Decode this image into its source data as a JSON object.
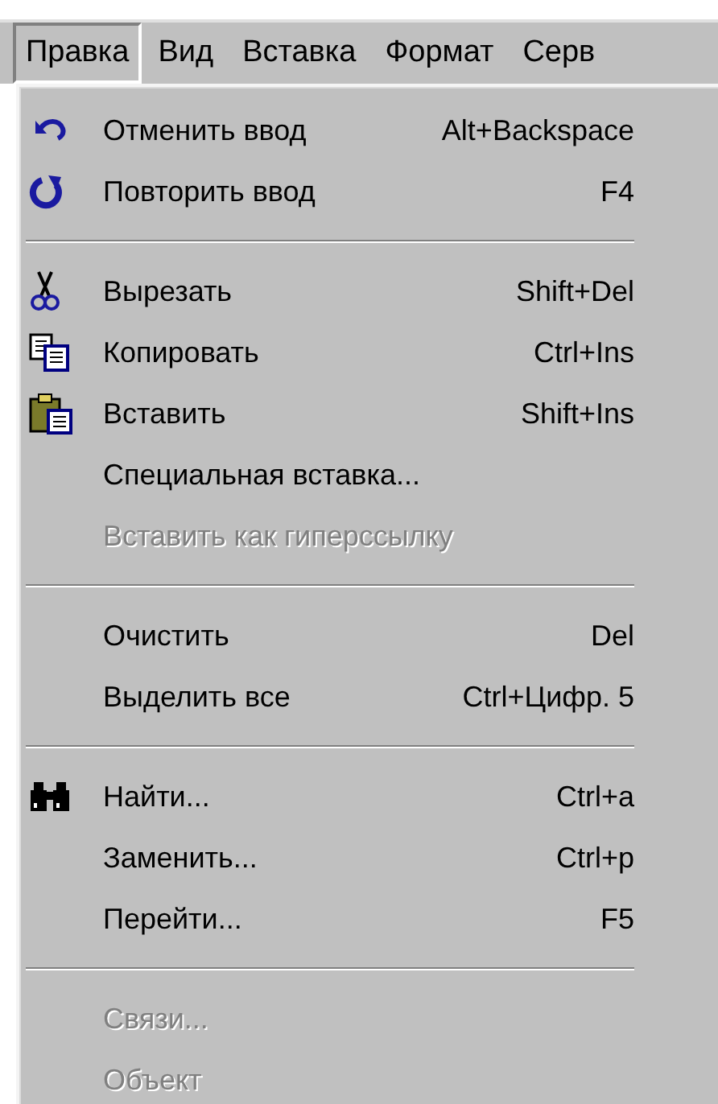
{
  "menubar": [
    {
      "label": "Правка",
      "selected": true
    },
    {
      "label": "Вид",
      "selected": false
    },
    {
      "label": "Вставка",
      "selected": false
    },
    {
      "label": "Формат",
      "selected": false
    },
    {
      "label": "Серв",
      "selected": false
    }
  ],
  "menu": [
    {
      "kind": "item",
      "label": "Отменить ввод",
      "shortcut": "Alt+Backspace",
      "disabled": false
    },
    {
      "kind": "item",
      "label": "Повторить ввод",
      "shortcut": "F4",
      "disabled": false
    },
    {
      "kind": "separator"
    },
    {
      "kind": "item",
      "label": "Вырезать",
      "shortcut": "Shift+Del",
      "disabled": false
    },
    {
      "kind": "item",
      "label": "Копировать",
      "shortcut": "Ctrl+Ins",
      "disabled": false
    },
    {
      "kind": "item",
      "label": "Вставить",
      "shortcut": "Shift+Ins",
      "disabled": false
    },
    {
      "kind": "item",
      "label": "Специальная вставка...",
      "disabled": false
    },
    {
      "kind": "item",
      "label": "Вставить как гиперссылку",
      "disabled": true
    },
    {
      "kind": "separator"
    },
    {
      "kind": "item",
      "label": "Очистить",
      "shortcut": "Del",
      "disabled": false
    },
    {
      "kind": "item",
      "label": "Выделить все",
      "shortcut": "Ctrl+Цифр. 5",
      "disabled": false
    },
    {
      "kind": "separator"
    },
    {
      "kind": "item",
      "label": "Найти...",
      "shortcut": "Ctrl+a",
      "disabled": false
    },
    {
      "kind": "item",
      "label": "Заменить...",
      "shortcut": "Ctrl+p",
      "disabled": false
    },
    {
      "kind": "item",
      "label": "Перейти...",
      "shortcut": "F5",
      "disabled": false
    },
    {
      "kind": "separator"
    },
    {
      "kind": "item",
      "label": "Связи...",
      "disabled": true
    },
    {
      "kind": "item",
      "label": "Объект",
      "disabled": true
    }
  ]
}
